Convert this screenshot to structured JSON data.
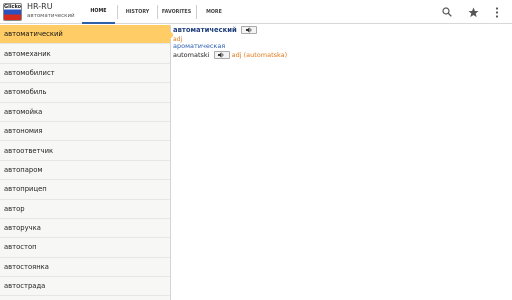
{
  "header": {
    "logo_text": "Glicko",
    "title": "HR-RU",
    "subtitle": "автоматический",
    "tabs": [
      {
        "label": "HOME"
      },
      {
        "label": "HISTORY"
      },
      {
        "label": "FAVORITES"
      },
      {
        "label": "MORE"
      }
    ],
    "icons": [
      "search-icon",
      "star-icon",
      "overflow-menu-icon"
    ]
  },
  "word_list": {
    "selected_index": 0,
    "items": [
      {
        "label": "автоматический"
      },
      {
        "label": "автомеханик"
      },
      {
        "label": "автомобилист"
      },
      {
        "label": "автомобиль"
      },
      {
        "label": "автомойка"
      },
      {
        "label": "автономия"
      },
      {
        "label": "автоответчик"
      },
      {
        "label": "автопаром"
      },
      {
        "label": "автоприцеп"
      },
      {
        "label": "автор"
      },
      {
        "label": "авторучка"
      },
      {
        "label": "автостоп"
      },
      {
        "label": "автостоянка"
      },
      {
        "label": "автострада"
      }
    ]
  },
  "entry": {
    "headword": "автоматический",
    "pos": "adj",
    "definition": "ароматическая",
    "translation": {
      "word": "automatski",
      "pos": "adj",
      "form": "(automatska)"
    }
  },
  "colors": {
    "selected_bg": "#ffcc66",
    "headword": "#1f3f7a",
    "pos": "#e07b1a",
    "definition": "#2a5db0",
    "tab_active": "#2f5fa8"
  }
}
